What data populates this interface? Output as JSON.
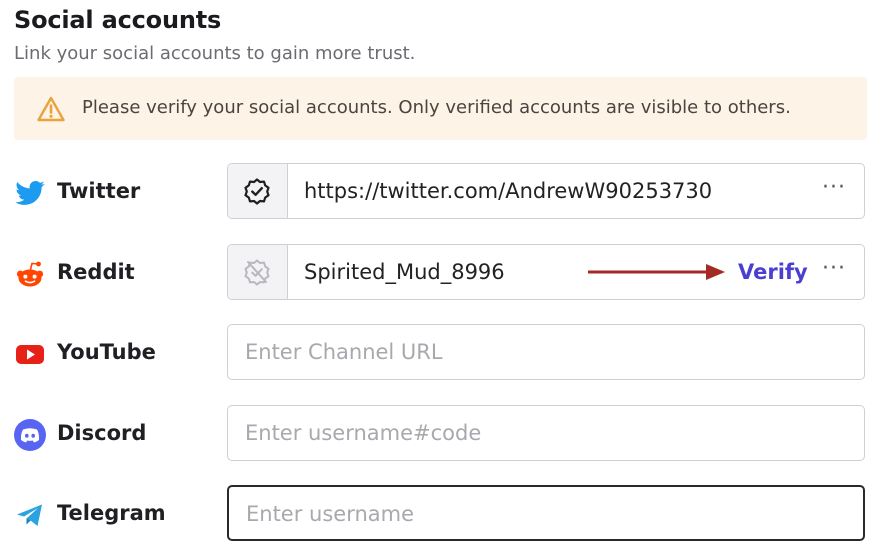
{
  "header": {
    "title": "Social accounts",
    "subtitle": "Link your social accounts to gain more trust."
  },
  "notice": {
    "icon": "warning-triangle-icon",
    "text": "Please verify your social accounts. Only verified accounts are visible to others."
  },
  "accounts": {
    "twitter": {
      "label": "Twitter",
      "icon": "twitter-bird-icon",
      "value": "https://twitter.com/AndrewW90253730",
      "status": "verified"
    },
    "reddit": {
      "label": "Reddit",
      "icon": "reddit-alien-icon",
      "value": "Spirited_Mud_8996",
      "status": "unverified",
      "verify_label": "Verify"
    },
    "youtube": {
      "label": "YouTube",
      "icon": "youtube-play-icon",
      "placeholder": "Enter Channel URL"
    },
    "discord": {
      "label": "Discord",
      "icon": "discord-icon",
      "placeholder": "Enter username#code"
    },
    "telegram": {
      "label": "Telegram",
      "icon": "telegram-plane-icon",
      "placeholder": "Enter username"
    }
  },
  "more_label": "···",
  "colors": {
    "notice_bg": "#fdf3e6",
    "warning": "#e8a33d",
    "verify": "#4b3fcf",
    "arrow": "#a32a25",
    "twitter": "#1d9bf0",
    "reddit": "#ff4500",
    "youtube": "#e62117",
    "discord": "#5865f2",
    "telegram": "#2aa3df"
  }
}
